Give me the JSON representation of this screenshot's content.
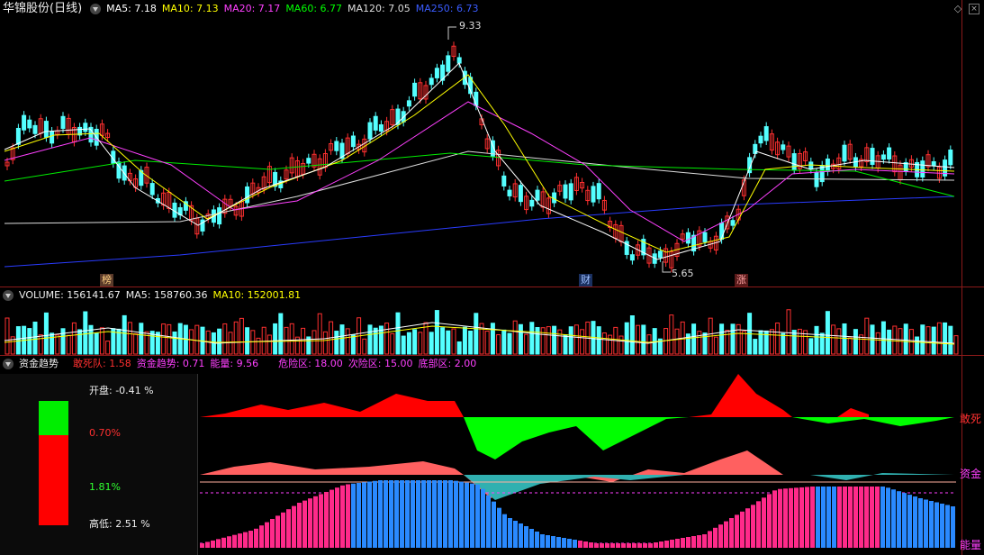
{
  "main": {
    "title": "华锦股份(日线)",
    "ma": [
      {
        "label": "MA5: 7.18",
        "color": "#ffffff"
      },
      {
        "label": "MA10: 7.13",
        "color": "#ffff00"
      },
      {
        "label": "MA20: 7.17",
        "color": "#ff40ff"
      },
      {
        "label": "MA60: 6.77",
        "color": "#00ff00"
      },
      {
        "label": "MA120: 7.05",
        "color": "#dddddd"
      },
      {
        "label": "MA250: 6.73",
        "color": "#3355ff"
      }
    ],
    "high_label": "9.33",
    "low_label": "5.65",
    "markers": [
      "榜",
      "财",
      "涨"
    ]
  },
  "volume": {
    "label": "VOLUME: 156141.67",
    "ma5": "MA5: 158760.36",
    "ma10": "MA10: 152001.81"
  },
  "fund": {
    "title": "资金趋势",
    "items": [
      {
        "label": "敢死队: 1.58",
        "color": "#ff3030"
      },
      {
        "label": "资金趋势: 0.71",
        "color": "#ff40ff"
      },
      {
        "label": "能量: 9.56",
        "color": "#ff40ff"
      },
      {
        "label": "危险区: 18.00",
        "color": "#ff40ff"
      },
      {
        "label": "次险区: 15.00",
        "color": "#ff40ff"
      },
      {
        "label": "底部区: 2.00",
        "color": "#ff40ff"
      }
    ],
    "right_labels": [
      "敢死",
      "资金",
      "能量"
    ]
  },
  "sidebar": {
    "open": "开盘: -0.41 %",
    "upper": "0.70%",
    "lower": "1.81%",
    "hilo": "高低: 2.51 %"
  }
}
